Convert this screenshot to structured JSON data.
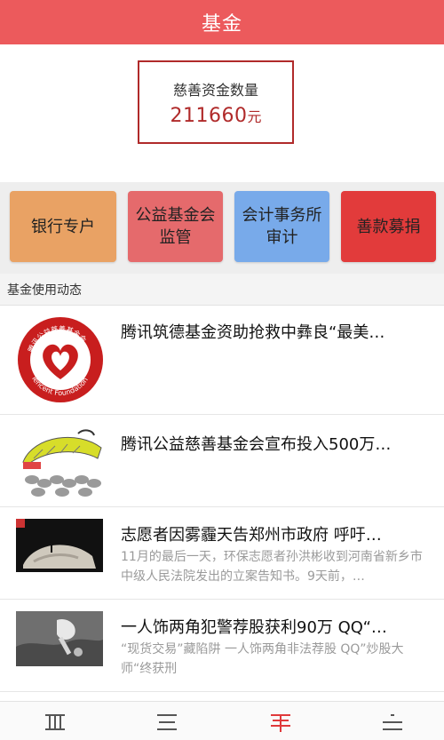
{
  "header": {
    "title": "基金"
  },
  "fund": {
    "label": "慈善资金数量",
    "amount": "211660",
    "unit": "元"
  },
  "tiles": [
    {
      "label": "银行专户"
    },
    {
      "label_line1": "公益基金会",
      "label_line2": "监管"
    },
    {
      "label_line1": "会计事务所",
      "label_line2": "审计"
    },
    {
      "label": "善款募捐"
    }
  ],
  "section": {
    "title": "基金使用动态"
  },
  "news": [
    {
      "title": "腾讯筑德基金资助抢救中彝良“最美…",
      "logo_text_top": "腾讯公益慈善基金会",
      "logo_text_bottom": "Tencent Foundation"
    },
    {
      "title": "腾讯公益慈善基金会宣布投入500万…"
    },
    {
      "title": "志愿者因雾霾天告郑州市政府 呼吁…",
      "desc": "11月的最后一天，环保志愿者孙洪彬收到河南省新乡市中级人民法院发出的立案告知书。9天前，…"
    },
    {
      "title": "一人饰两角犯警荐股获利90万 QQ“…",
      "desc": "“现货交易”藏陷阱 一人饰两角非法荐股 QQ”炒股大师“终获刑"
    }
  ],
  "colors": {
    "header": "#ec5a5c",
    "accent": "#b02a2a",
    "nav_active": "#e0393b"
  },
  "bottom_nav": {
    "icons": [
      "grid-tab-icon",
      "list-tab-icon",
      "fund-tab-icon",
      "more-tab-icon"
    ],
    "active_index": 2
  }
}
